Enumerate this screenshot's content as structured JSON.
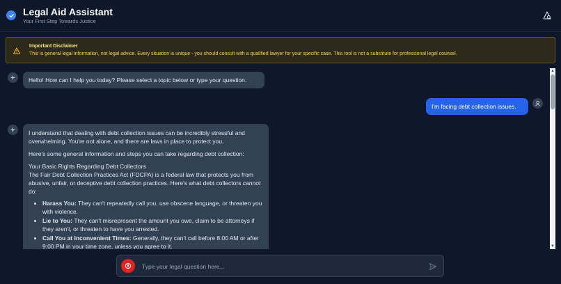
{
  "app": {
    "title": "Legal Aid Assistant",
    "subtitle": "Your First Step Towards Justice"
  },
  "disclaimer": {
    "title": "Important Disclaimer",
    "text": "This is general legal information, not legal advice. Every situation is unique - you should consult with a qualified lawyer for your specific case. This tool is not a substitute for professional legal counsel."
  },
  "messages": {
    "greeting": "Hello! How can I help you today? Please select a topic below or type your question.",
    "user_question": "I'm facing debt collection issues.",
    "response": {
      "intro": "I understand that dealing with debt collection issues can be incredibly stressful and overwhelming. You're not alone, and there are laws in place to protect you.",
      "lead": "Here's some general information and steps you can take regarding debt collection:",
      "heading": "Your Basic Rights Regarding Debt Collectors",
      "fdcpa_before": "The Fair Debt Collection Practices Act (FDCPA) is a federal law that protects you from abusive, unfair, or deceptive debt collection practices. Here's what debt collectors",
      "fdcpa_em": "cannot",
      "fdcpa_after": "do:",
      "bullets": [
        {
          "label": "Harass You:",
          "text": "They can't repeatedly call you, use obscene language, or threaten you with violence."
        },
        {
          "label": "Lie to You:",
          "text": "They can't misrepresent the amount you owe, claim to be attorneys if they aren't, or threaten to have you arrested."
        },
        {
          "label": "Call You at Inconvenient Times:",
          "text": "Generally, they can't call before 8:00 AM or after 9:00 PM in your time zone, unless you agree to it."
        }
      ]
    }
  },
  "input": {
    "placeholder": "Type your legal question here..."
  },
  "colors": {
    "background": "#0f172a",
    "accent": "#2563eb",
    "warning": "#fcd34d",
    "mic": "#dc2626"
  }
}
